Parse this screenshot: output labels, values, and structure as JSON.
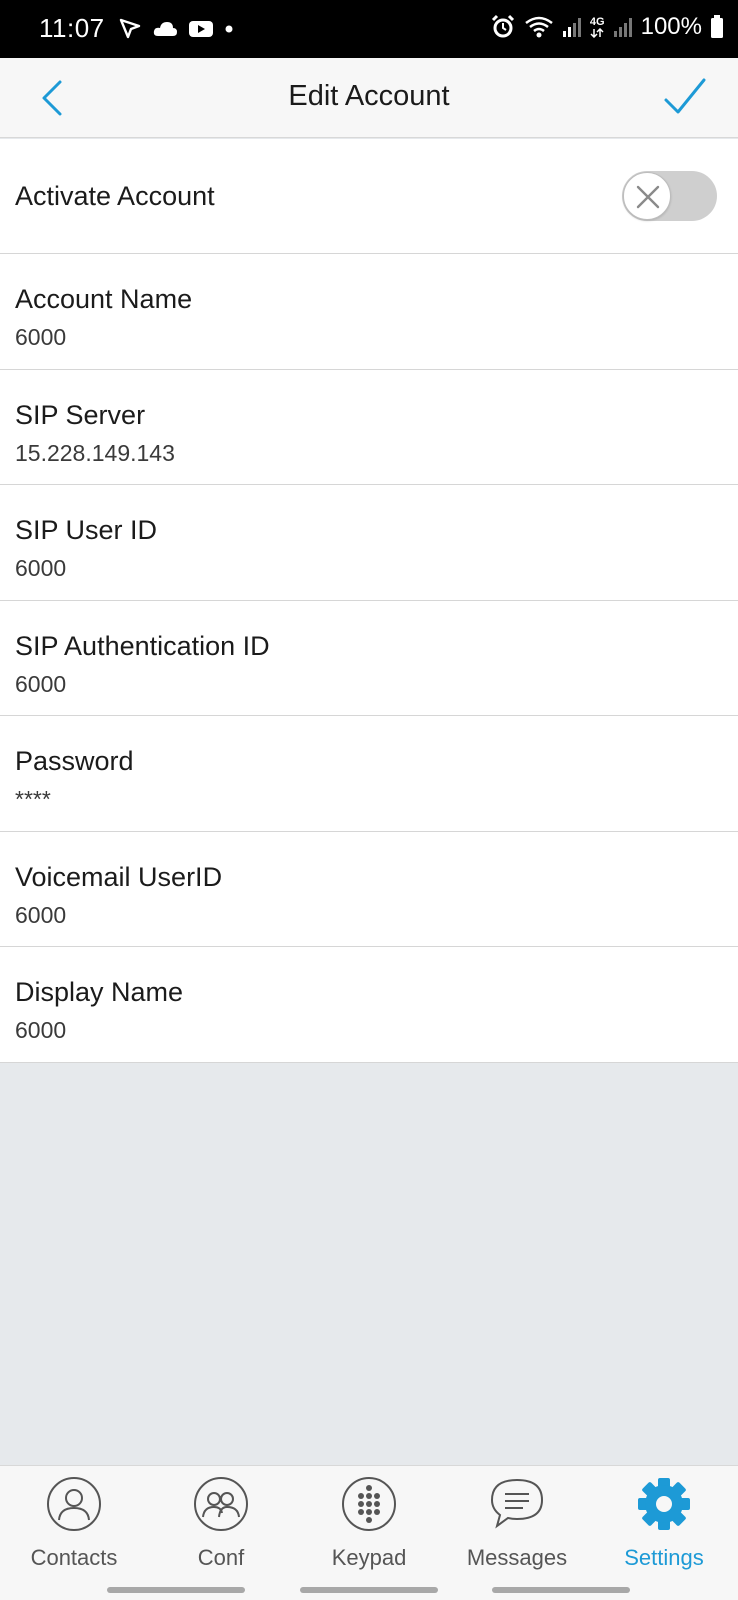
{
  "status_bar": {
    "time": "11:07",
    "left_icons": [
      "navigation-arrow-icon",
      "cloud-icon",
      "youtube-icon",
      "dot-icon"
    ],
    "right_icons": [
      "alarm-icon",
      "wifi-icon",
      "signal-icon",
      "4g-icon",
      "signal-icon",
      "battery-icon"
    ],
    "network_label": "4G",
    "battery": "100%"
  },
  "header": {
    "title": "Edit Account",
    "back_icon": "chevron-left-icon",
    "confirm_icon": "check-icon"
  },
  "activate": {
    "label": "Activate Account",
    "enabled": false
  },
  "fields": [
    {
      "label": "Account Name",
      "value": "6000"
    },
    {
      "label": "SIP Server",
      "value": "15.228.149.143"
    },
    {
      "label": "SIP User ID",
      "value": "6000"
    },
    {
      "label": "SIP Authentication ID",
      "value": "6000"
    },
    {
      "label": "Password",
      "value": "****"
    },
    {
      "label": "Voicemail UserID",
      "value": "6000"
    },
    {
      "label": "Display Name",
      "value": "6000"
    }
  ],
  "nav": {
    "items": [
      {
        "label": "Contacts",
        "icon": "contacts-icon",
        "active": false
      },
      {
        "label": "Conf",
        "icon": "conference-icon",
        "active": false
      },
      {
        "label": "Keypad",
        "icon": "keypad-icon",
        "active": false
      },
      {
        "label": "Messages",
        "icon": "messages-icon",
        "active": false
      },
      {
        "label": "Settings",
        "icon": "gear-icon",
        "active": true
      }
    ]
  },
  "colors": {
    "accent": "#1d9ad6",
    "header_bg": "#f7f7f7",
    "page_bg": "#e6e9ec",
    "toggle_off": "#cfcfcf"
  }
}
